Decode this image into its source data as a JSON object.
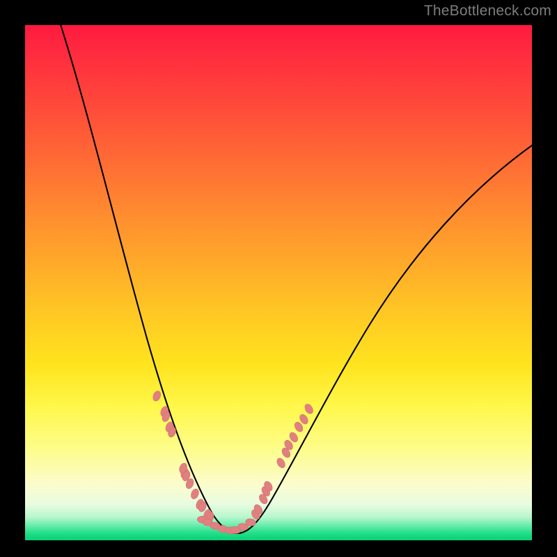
{
  "watermark": "TheBottleneck.com",
  "colors": {
    "gradient_top": "#ff1a3f",
    "gradient_mid": "#ffe41e",
    "gradient_bottom": "#0bd176",
    "curve": "#000000",
    "marker_fill": "#e08080",
    "marker_stroke": "#d86e6e",
    "frame": "#000000"
  },
  "chart_data": {
    "type": "line",
    "title": "",
    "xlabel": "",
    "ylabel": "",
    "xlim": [
      0,
      100
    ],
    "ylim": [
      0,
      100
    ],
    "x": [
      5,
      10,
      15,
      20,
      22,
      24,
      26,
      28,
      30,
      32,
      34,
      36,
      38,
      40,
      42,
      44,
      46,
      50,
      55,
      60,
      65,
      70,
      75,
      80,
      85,
      90,
      95,
      100
    ],
    "values": [
      100,
      90,
      72,
      52,
      44,
      36,
      29,
      23,
      17,
      12,
      8,
      5,
      3,
      2,
      1.8,
      3,
      6,
      13,
      23,
      33,
      42,
      50,
      58,
      64,
      70,
      75,
      79,
      82
    ],
    "series": [
      {
        "name": "markers_left",
        "x": [
          26,
          27.5,
          27.8,
          28.5,
          29,
          31.5,
          31.2,
          31.8,
          32.5,
          33.5,
          34.5,
          35,
          36,
          36.5
        ],
        "values": [
          28,
          25,
          24,
          22,
          21,
          13,
          14,
          12.5,
          11,
          9,
          7,
          6.5,
          5,
          4.5
        ]
      },
      {
        "name": "markers_bottom",
        "x": [
          35,
          36,
          37.5,
          39,
          40.5,
          41.5,
          43,
          44.5
        ],
        "values": [
          4,
          3.5,
          2.8,
          2.2,
          1.9,
          2.0,
          2.6,
          3.5
        ]
      },
      {
        "name": "markers_right",
        "x": [
          45.5,
          46,
          47,
          47.5,
          48,
          50.5,
          51.5,
          52,
          53,
          54,
          55,
          56
        ],
        "values": [
          5,
          6,
          8,
          9.5,
          10.5,
          15,
          17,
          18.5,
          20,
          22,
          23.5,
          25.5
        ]
      }
    ]
  }
}
